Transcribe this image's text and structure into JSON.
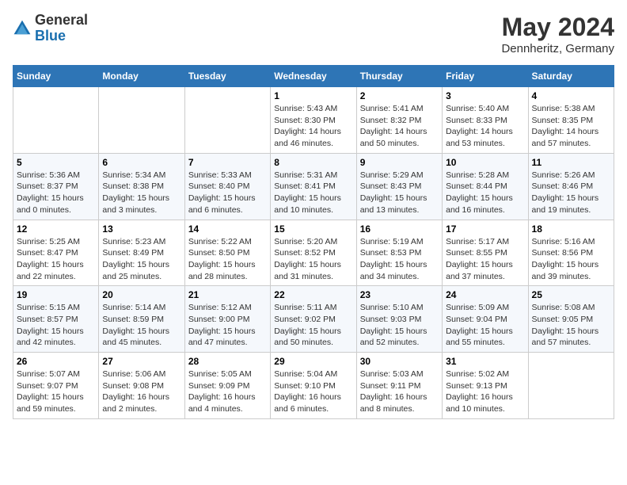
{
  "header": {
    "logo_general": "General",
    "logo_blue": "Blue",
    "month_title": "May 2024",
    "location": "Dennheritz, Germany"
  },
  "weekdays": [
    "Sunday",
    "Monday",
    "Tuesday",
    "Wednesday",
    "Thursday",
    "Friday",
    "Saturday"
  ],
  "weeks": [
    [
      {
        "day": "",
        "info": ""
      },
      {
        "day": "",
        "info": ""
      },
      {
        "day": "",
        "info": ""
      },
      {
        "day": "1",
        "info": "Sunrise: 5:43 AM\nSunset: 8:30 PM\nDaylight: 14 hours\nand 46 minutes."
      },
      {
        "day": "2",
        "info": "Sunrise: 5:41 AM\nSunset: 8:32 PM\nDaylight: 14 hours\nand 50 minutes."
      },
      {
        "day": "3",
        "info": "Sunrise: 5:40 AM\nSunset: 8:33 PM\nDaylight: 14 hours\nand 53 minutes."
      },
      {
        "day": "4",
        "info": "Sunrise: 5:38 AM\nSunset: 8:35 PM\nDaylight: 14 hours\nand 57 minutes."
      }
    ],
    [
      {
        "day": "5",
        "info": "Sunrise: 5:36 AM\nSunset: 8:37 PM\nDaylight: 15 hours\nand 0 minutes."
      },
      {
        "day": "6",
        "info": "Sunrise: 5:34 AM\nSunset: 8:38 PM\nDaylight: 15 hours\nand 3 minutes."
      },
      {
        "day": "7",
        "info": "Sunrise: 5:33 AM\nSunset: 8:40 PM\nDaylight: 15 hours\nand 6 minutes."
      },
      {
        "day": "8",
        "info": "Sunrise: 5:31 AM\nSunset: 8:41 PM\nDaylight: 15 hours\nand 10 minutes."
      },
      {
        "day": "9",
        "info": "Sunrise: 5:29 AM\nSunset: 8:43 PM\nDaylight: 15 hours\nand 13 minutes."
      },
      {
        "day": "10",
        "info": "Sunrise: 5:28 AM\nSunset: 8:44 PM\nDaylight: 15 hours\nand 16 minutes."
      },
      {
        "day": "11",
        "info": "Sunrise: 5:26 AM\nSunset: 8:46 PM\nDaylight: 15 hours\nand 19 minutes."
      }
    ],
    [
      {
        "day": "12",
        "info": "Sunrise: 5:25 AM\nSunset: 8:47 PM\nDaylight: 15 hours\nand 22 minutes."
      },
      {
        "day": "13",
        "info": "Sunrise: 5:23 AM\nSunset: 8:49 PM\nDaylight: 15 hours\nand 25 minutes."
      },
      {
        "day": "14",
        "info": "Sunrise: 5:22 AM\nSunset: 8:50 PM\nDaylight: 15 hours\nand 28 minutes."
      },
      {
        "day": "15",
        "info": "Sunrise: 5:20 AM\nSunset: 8:52 PM\nDaylight: 15 hours\nand 31 minutes."
      },
      {
        "day": "16",
        "info": "Sunrise: 5:19 AM\nSunset: 8:53 PM\nDaylight: 15 hours\nand 34 minutes."
      },
      {
        "day": "17",
        "info": "Sunrise: 5:17 AM\nSunset: 8:55 PM\nDaylight: 15 hours\nand 37 minutes."
      },
      {
        "day": "18",
        "info": "Sunrise: 5:16 AM\nSunset: 8:56 PM\nDaylight: 15 hours\nand 39 minutes."
      }
    ],
    [
      {
        "day": "19",
        "info": "Sunrise: 5:15 AM\nSunset: 8:57 PM\nDaylight: 15 hours\nand 42 minutes."
      },
      {
        "day": "20",
        "info": "Sunrise: 5:14 AM\nSunset: 8:59 PM\nDaylight: 15 hours\nand 45 minutes."
      },
      {
        "day": "21",
        "info": "Sunrise: 5:12 AM\nSunset: 9:00 PM\nDaylight: 15 hours\nand 47 minutes."
      },
      {
        "day": "22",
        "info": "Sunrise: 5:11 AM\nSunset: 9:02 PM\nDaylight: 15 hours\nand 50 minutes."
      },
      {
        "day": "23",
        "info": "Sunrise: 5:10 AM\nSunset: 9:03 PM\nDaylight: 15 hours\nand 52 minutes."
      },
      {
        "day": "24",
        "info": "Sunrise: 5:09 AM\nSunset: 9:04 PM\nDaylight: 15 hours\nand 55 minutes."
      },
      {
        "day": "25",
        "info": "Sunrise: 5:08 AM\nSunset: 9:05 PM\nDaylight: 15 hours\nand 57 minutes."
      }
    ],
    [
      {
        "day": "26",
        "info": "Sunrise: 5:07 AM\nSunset: 9:07 PM\nDaylight: 15 hours\nand 59 minutes."
      },
      {
        "day": "27",
        "info": "Sunrise: 5:06 AM\nSunset: 9:08 PM\nDaylight: 16 hours\nand 2 minutes."
      },
      {
        "day": "28",
        "info": "Sunrise: 5:05 AM\nSunset: 9:09 PM\nDaylight: 16 hours\nand 4 minutes."
      },
      {
        "day": "29",
        "info": "Sunrise: 5:04 AM\nSunset: 9:10 PM\nDaylight: 16 hours\nand 6 minutes."
      },
      {
        "day": "30",
        "info": "Sunrise: 5:03 AM\nSunset: 9:11 PM\nDaylight: 16 hours\nand 8 minutes."
      },
      {
        "day": "31",
        "info": "Sunrise: 5:02 AM\nSunset: 9:13 PM\nDaylight: 16 hours\nand 10 minutes."
      },
      {
        "day": "",
        "info": ""
      }
    ]
  ]
}
